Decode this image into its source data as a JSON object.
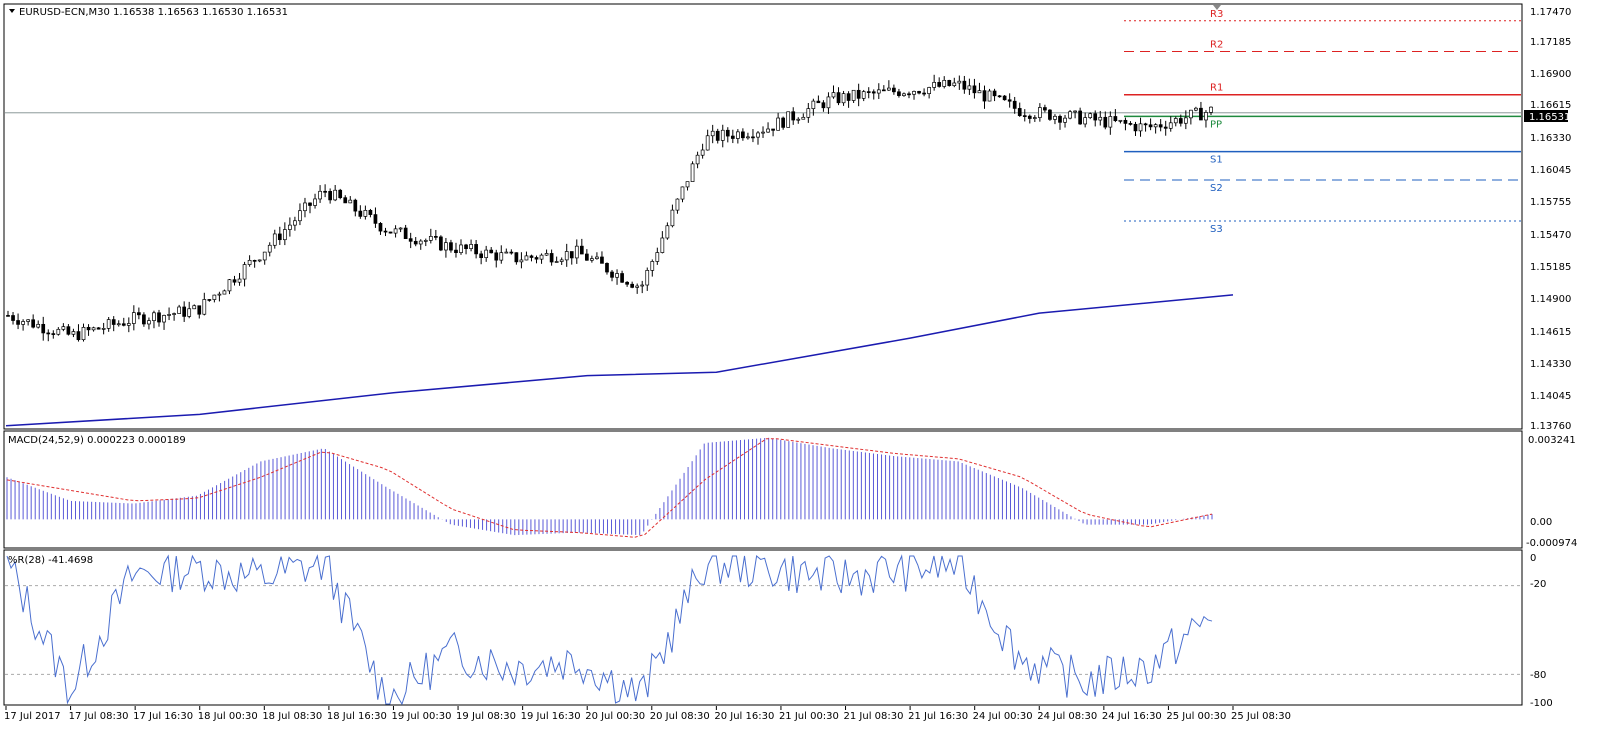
{
  "price_pane": {
    "header": "EURUSD-ECN,M30  1.16538 1.16563 1.16530 1.16531",
    "price_axis": [
      "1.17470",
      "1.17185",
      "1.16900",
      "1.16615",
      "1.16330",
      "1.16045",
      "1.15755",
      "1.15470",
      "1.15185",
      "1.14900",
      "1.14615",
      "1.14330",
      "1.14045",
      "1.13760"
    ],
    "current_price_label": "1.16531",
    "pivot_labels": {
      "r3": "R3",
      "r2": "R2",
      "r1": "R1",
      "pp": "PP",
      "s1": "S1",
      "s2": "S2",
      "s3": "S3"
    },
    "colors": {
      "r": "#dd2222",
      "pp": "#1e8a3e",
      "s": "#1f5fbf",
      "ma": "#1b1bb0",
      "candle": "#000000"
    }
  },
  "macd_pane": {
    "header": "MACD(24,52,9) 0.000223 0.000189",
    "axis": [
      "0.003241",
      "0.00",
      "-0.000974"
    ],
    "colors": {
      "hist": "#5a5ad8",
      "signal": "#e03030"
    }
  },
  "wpr_pane": {
    "header": "%R(28) -41.4698",
    "axis": [
      "0",
      "-20",
      "-80",
      "-100"
    ],
    "colors": {
      "line": "#4a6fcf"
    }
  },
  "time_axis": [
    "17 Jul 2017",
    "17 Jul 08:30",
    "17 Jul 16:30",
    "18 Jul 00:30",
    "18 Jul 08:30",
    "18 Jul 16:30",
    "19 Jul 00:30",
    "19 Jul 08:30",
    "19 Jul 16:30",
    "20 Jul 00:30",
    "20 Jul 08:30",
    "20 Jul 16:30",
    "21 Jul 00:30",
    "21 Jul 08:30",
    "21 Jul 16:30",
    "24 Jul 00:30",
    "24 Jul 08:30",
    "24 Jul 16:30",
    "25 Jul 00:30",
    "25 Jul 08:30"
  ],
  "chart_data": [
    {
      "type": "line",
      "series": [
        {
          "name": "EURUSD-ECN,M30",
          "x": [
            "17 Jul 2017",
            "17 Jul 08:30",
            "17 Jul 16:30",
            "18 Jul 00:30",
            "18 Jul 08:30",
            "18 Jul 16:30",
            "19 Jul 00:30",
            "19 Jul 08:30",
            "19 Jul 16:30",
            "20 Jul 00:30",
            "20 Jul 08:30",
            "20 Jul 16:30",
            "21 Jul 00:30",
            "21 Jul 08:30",
            "21 Jul 16:30",
            "24 Jul 00:30",
            "24 Jul 08:30",
            "24 Jul 16:30",
            "25 Jul 00:30",
            "25 Jul 08:30"
          ],
          "values": [
            1.1475,
            1.1457,
            1.1472,
            1.148,
            1.153,
            1.1585,
            1.155,
            1.1535,
            1.1525,
            1.153,
            1.15,
            1.163,
            1.164,
            1.1665,
            1.1672,
            1.1678,
            1.1655,
            1.1648,
            1.164,
            1.1655
          ]
        },
        {
          "name": "MA",
          "x": [
            "17 Jul 2017",
            "18 Jul 00:30",
            "19 Jul 00:30",
            "20 Jul 00:30",
            "20 Jul 16:30",
            "21 Jul 16:30",
            "24 Jul 08:30",
            "25 Jul 08:30"
          ],
          "values": [
            1.1378,
            1.1388,
            1.1407,
            1.1422,
            1.1425,
            1.1455,
            1.1477,
            1.1493
          ]
        }
      ],
      "pivots": {
        "R3": 1.1734,
        "R2": 1.1707,
        "R1": 1.1669,
        "PP": 1.165,
        "S1": 1.1619,
        "S2": 1.1594,
        "S3": 1.1558
      },
      "current_price": 1.16531,
      "ylim": [
        1.1376,
        1.1747
      ]
    },
    {
      "type": "bar",
      "title": "MACD(24,52,9) 0.000223 0.000189",
      "x": [
        "17 Jul 2017",
        "17 Jul 08:30",
        "17 Jul 16:30",
        "18 Jul 00:30",
        "18 Jul 08:30",
        "18 Jul 16:30",
        "19 Jul 00:30",
        "19 Jul 08:30",
        "19 Jul 16:30",
        "20 Jul 00:30",
        "20 Jul 08:30",
        "20 Jul 16:30",
        "21 Jul 00:30",
        "21 Jul 08:30",
        "21 Jul 16:30",
        "24 Jul 00:30",
        "24 Jul 08:30",
        "24 Jul 16:30",
        "25 Jul 00:30",
        "25 Jul 08:30"
      ],
      "series": [
        {
          "name": "main",
          "values": [
            0.0016,
            0.0007,
            0.0006,
            0.0009,
            0.0022,
            0.0027,
            0.0012,
            -0.0002,
            -0.0006,
            -0.0005,
            -0.0006,
            0.0029,
            0.0031,
            0.0027,
            0.0024,
            0.0022,
            0.0012,
            -0.0002,
            -0.0002,
            0.0002
          ]
        },
        {
          "name": "signal",
          "values": [
            0.0015,
            0.0011,
            0.0007,
            0.0008,
            0.0016,
            0.0026,
            0.0019,
            0.0004,
            -0.0004,
            -0.0005,
            -0.0007,
            0.0015,
            0.0031,
            0.0028,
            0.0025,
            0.0023,
            0.0016,
            0.0002,
            -0.0003,
            0.0002
          ]
        }
      ],
      "ylim": [
        -0.000974,
        0.003241
      ]
    },
    {
      "type": "line",
      "title": "%R(28) -41.4698",
      "x": [
        "17 Jul 2017",
        "17 Jul 08:30",
        "17 Jul 16:30",
        "18 Jul 00:30",
        "18 Jul 08:30",
        "18 Jul 16:30",
        "19 Jul 00:30",
        "19 Jul 08:30",
        "19 Jul 16:30",
        "20 Jul 00:30",
        "20 Jul 08:30",
        "20 Jul 16:30",
        "21 Jul 00:30",
        "21 Jul 08:30",
        "21 Jul 16:30",
        "24 Jul 00:30",
        "24 Jul 08:30",
        "24 Jul 16:30",
        "25 Jul 00:30",
        "25 Jul 08:30"
      ],
      "series": [
        {
          "name": "%R(28)",
          "values": [
            -5,
            -90,
            -12,
            -8,
            -15,
            -5,
            -98,
            -65,
            -75,
            -70,
            -95,
            -5,
            -8,
            -15,
            -10,
            -5,
            -70,
            -85,
            -75,
            -41
          ]
        }
      ],
      "ylim": [
        -100,
        0
      ]
    }
  ]
}
